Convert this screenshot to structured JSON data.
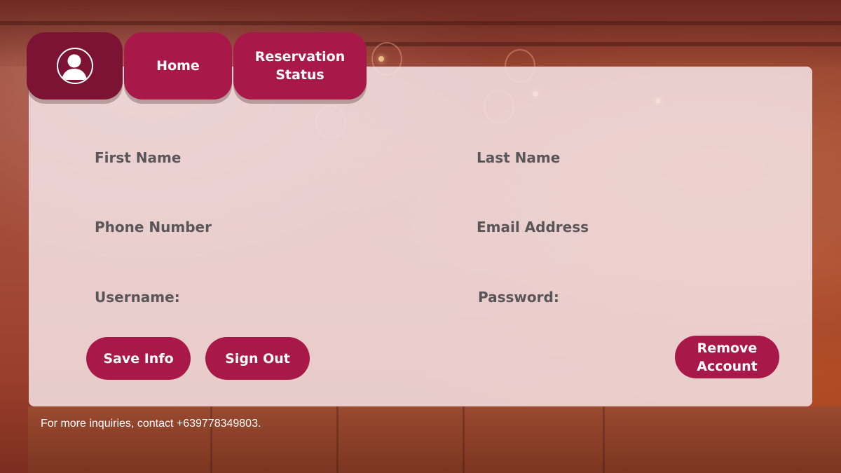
{
  "nav": {
    "profile_icon": "user-avatar-icon",
    "home_label": "Home",
    "reservation_label": "Reservation\nStatus"
  },
  "form": {
    "first_name_label": "First Name",
    "last_name_label": "Last Name",
    "phone_label": "Phone Number",
    "email_label": "Email Address",
    "username_label": "Username:",
    "password_label": "Password:"
  },
  "actions": {
    "save_label": "Save Info",
    "signout_label": "Sign Out",
    "remove_label": "Remove\nAccount"
  },
  "footer": {
    "contact_text": "For more inquiries, contact +639778349803."
  },
  "colors": {
    "accent": "#a8194a",
    "accent_dark": "#7c1334",
    "card_bg": "#f5e4e6",
    "label_text": "#5a5558"
  }
}
